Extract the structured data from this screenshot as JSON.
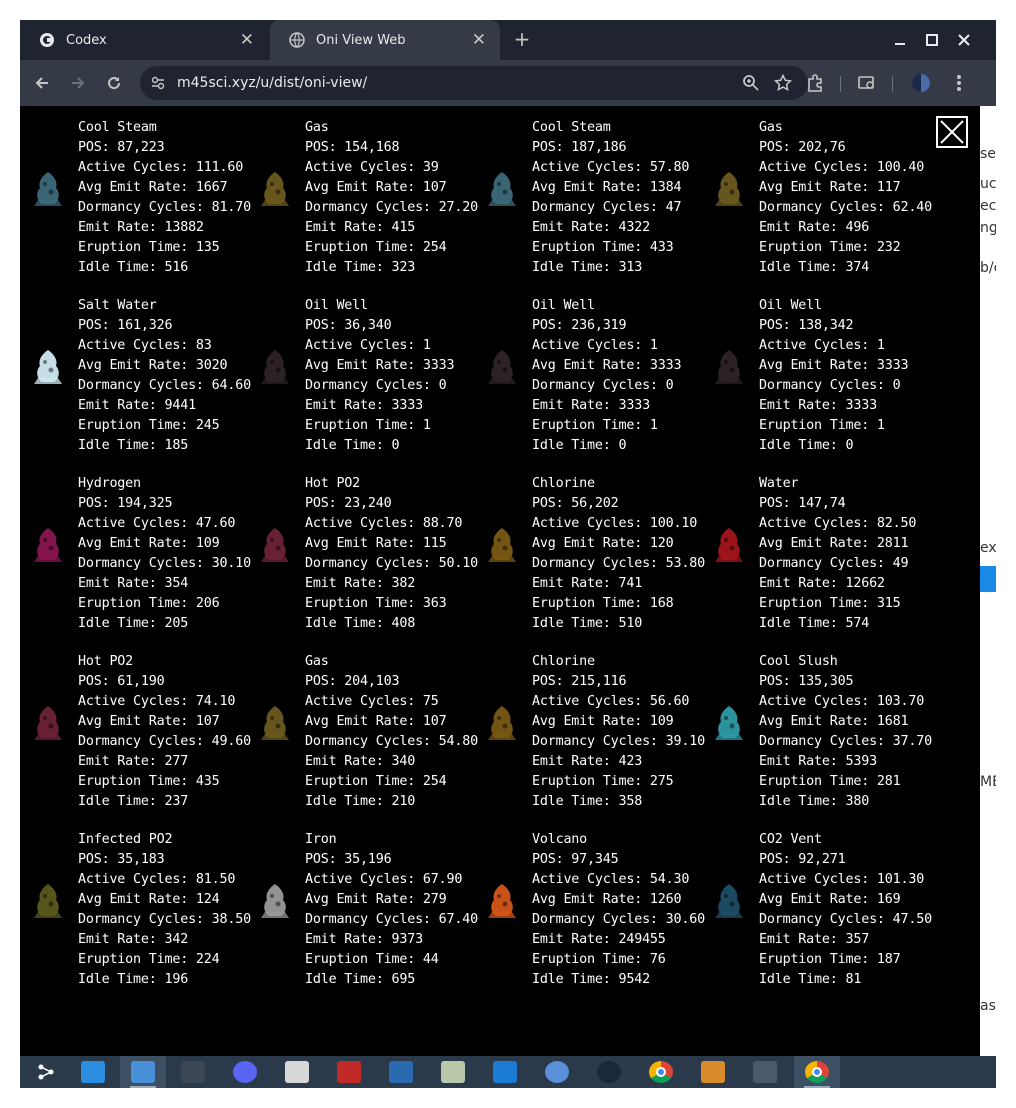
{
  "browser": {
    "tabs": [
      {
        "title": "Codex",
        "active": false
      },
      {
        "title": "Oni View Web",
        "active": true
      }
    ],
    "address": "m45sci.xyz/u/dist/oni-view/"
  },
  "geysers": [
    {
      "name": "Cool Steam",
      "pos": "POS: 87,223",
      "active": "Active Cycles: 111.60",
      "avg": "Avg Emit Rate: 1667",
      "dormancy": "Dormancy Cycles: 81.70",
      "emit": "Emit Rate: 13882",
      "eruption": "Eruption Time: 135",
      "idle": "Idle Time: 516",
      "icon": "cool-steam-vent-icon",
      "color": "#3c6a7a"
    },
    {
      "name": "Gas",
      "pos": "POS: 154,168",
      "active": "Active Cycles: 39",
      "avg": "Avg Emit Rate: 107",
      "dormancy": "Dormancy Cycles: 27.20",
      "emit": "Emit Rate: 415",
      "eruption": "Eruption Time: 254",
      "idle": "Idle Time: 323",
      "icon": "gas-vent-icon",
      "color": "#6b5a1e"
    },
    {
      "name": "Cool Steam",
      "pos": "POS: 187,186",
      "active": "Active Cycles: 57.80",
      "avg": "Avg Emit Rate: 1384",
      "dormancy": "Dormancy Cycles: 47",
      "emit": "Emit Rate: 4322",
      "eruption": "Eruption Time: 433",
      "idle": "Idle Time: 313",
      "icon": "cool-steam-vent-icon",
      "color": "#3c6a7a"
    },
    {
      "name": "Gas",
      "pos": "POS: 202,76",
      "active": "Active Cycles: 100.40",
      "avg": "Avg Emit Rate: 117",
      "dormancy": "Dormancy Cycles: 62.40",
      "emit": "Emit Rate: 496",
      "eruption": "Eruption Time: 232",
      "idle": "Idle Time: 374",
      "icon": "gas-vent-icon",
      "color": "#6b5a1e"
    },
    {
      "name": "Salt Water",
      "pos": "POS: 161,326",
      "active": "Active Cycles: 83",
      "avg": "Avg Emit Rate: 3020",
      "dormancy": "Dormancy Cycles: 64.60",
      "emit": "Emit Rate: 9441",
      "eruption": "Eruption Time: 245",
      "idle": "Idle Time: 185",
      "icon": "salt-water-geyser-icon",
      "color": "#cfe9f2"
    },
    {
      "name": "Oil Well",
      "pos": "POS: 36,340",
      "active": "Active Cycles: 1",
      "avg": "Avg Emit Rate: 3333",
      "dormancy": "Dormancy Cycles: 0",
      "emit": "Emit Rate: 3333",
      "eruption": "Eruption Time: 1",
      "idle": "Idle Time: 0",
      "icon": "oil-well-icon",
      "color": "#2e2428"
    },
    {
      "name": "Oil Well",
      "pos": "POS: 236,319",
      "active": "Active Cycles: 1",
      "avg": "Avg Emit Rate: 3333",
      "dormancy": "Dormancy Cycles: 0",
      "emit": "Emit Rate: 3333",
      "eruption": "Eruption Time: 1",
      "idle": "Idle Time: 0",
      "icon": "oil-well-icon",
      "color": "#2e2428"
    },
    {
      "name": "Oil Well",
      "pos": "POS: 138,342",
      "active": "Active Cycles: 1",
      "avg": "Avg Emit Rate: 3333",
      "dormancy": "Dormancy Cycles: 0",
      "emit": "Emit Rate: 3333",
      "eruption": "Eruption Time: 1",
      "idle": "Idle Time: 0",
      "icon": "oil-well-icon",
      "color": "#2e2428"
    },
    {
      "name": "Hydrogen",
      "pos": "POS: 194,325",
      "active": "Active Cycles: 47.60",
      "avg": "Avg Emit Rate: 109",
      "dormancy": "Dormancy Cycles: 30.10",
      "emit": "Emit Rate: 354",
      "eruption": "Eruption Time: 206",
      "idle": "Idle Time: 205",
      "icon": "hydrogen-vent-icon",
      "color": "#8a1650"
    },
    {
      "name": "Hot PO2",
      "pos": "POS: 23,240",
      "active": "Active Cycles: 88.70",
      "avg": "Avg Emit Rate: 115",
      "dormancy": "Dormancy Cycles: 50.10",
      "emit": "Emit Rate: 382",
      "eruption": "Eruption Time: 363",
      "idle": "Idle Time: 408",
      "icon": "hot-polluted-oxygen-vent-icon",
      "color": "#6e2238"
    },
    {
      "name": "Chlorine",
      "pos": "POS: 56,202",
      "active": "Active Cycles: 100.10",
      "avg": "Avg Emit Rate: 120",
      "dormancy": "Dormancy Cycles: 53.80",
      "emit": "Emit Rate: 741",
      "eruption": "Eruption Time: 168",
      "idle": "Idle Time: 510",
      "icon": "chlorine-vent-icon",
      "color": "#7a5814"
    },
    {
      "name": "Water",
      "pos": "POS: 147,74",
      "active": "Active Cycles: 82.50",
      "avg": "Avg Emit Rate: 2811",
      "dormancy": "Dormancy Cycles: 49",
      "emit": "Emit Rate: 12662",
      "eruption": "Eruption Time: 315",
      "idle": "Idle Time: 574",
      "icon": "water-geyser-icon",
      "color": "#a3151a"
    },
    {
      "name": "Hot PO2",
      "pos": "POS: 61,190",
      "active": "Active Cycles: 74.10",
      "avg": "Avg Emit Rate: 107",
      "dormancy": "Dormancy Cycles: 49.60",
      "emit": "Emit Rate: 277",
      "eruption": "Eruption Time: 435",
      "idle": "Idle Time: 237",
      "icon": "hot-polluted-oxygen-vent-icon",
      "color": "#6e2238"
    },
    {
      "name": "Gas",
      "pos": "POS: 204,103",
      "active": "Active Cycles: 75",
      "avg": "Avg Emit Rate: 107",
      "dormancy": "Dormancy Cycles: 54.80",
      "emit": "Emit Rate: 340",
      "eruption": "Eruption Time: 254",
      "idle": "Idle Time: 210",
      "icon": "gas-vent-icon",
      "color": "#6b5a1e"
    },
    {
      "name": "Chlorine",
      "pos": "POS: 215,116",
      "active": "Active Cycles: 56.60",
      "avg": "Avg Emit Rate: 109",
      "dormancy": "Dormancy Cycles: 39.10",
      "emit": "Emit Rate: 423",
      "eruption": "Eruption Time: 275",
      "idle": "Idle Time: 358",
      "icon": "chlorine-vent-icon",
      "color": "#7a5814"
    },
    {
      "name": "Cool Slush",
      "pos": "POS: 135,305",
      "active": "Active Cycles: 103.70",
      "avg": "Avg Emit Rate: 1681",
      "dormancy": "Dormancy Cycles: 37.70",
      "emit": "Emit Rate: 5393",
      "eruption": "Eruption Time: 281",
      "idle": "Idle Time: 380",
      "icon": "cool-slush-geyser-icon",
      "color": "#2e9aa6"
    },
    {
      "name": "Infected PO2",
      "pos": "POS: 35,183",
      "active": "Active Cycles: 81.50",
      "avg": "Avg Emit Rate: 124",
      "dormancy": "Dormancy Cycles: 38.50",
      "emit": "Emit Rate: 342",
      "eruption": "Eruption Time: 224",
      "idle": "Idle Time: 196",
      "icon": "infected-polluted-oxygen-vent-icon",
      "color": "#5a5a1e"
    },
    {
      "name": "Iron",
      "pos": "POS: 35,196",
      "active": "Active Cycles: 67.90",
      "avg": "Avg Emit Rate: 279",
      "dormancy": "Dormancy Cycles: 67.40",
      "emit": "Emit Rate: 9373",
      "eruption": "Eruption Time: 44",
      "idle": "Idle Time: 695",
      "icon": "iron-volcano-icon",
      "color": "#9a9a9a"
    },
    {
      "name": "Volcano",
      "pos": "POS: 97,345",
      "active": "Active Cycles: 54.30",
      "avg": "Avg Emit Rate: 1260",
      "dormancy": "Dormancy Cycles: 30.60",
      "emit": "Emit Rate: 249455",
      "eruption": "Eruption Time: 76",
      "idle": "Idle Time: 9542",
      "icon": "volcano-icon",
      "color": "#d4561a"
    },
    {
      "name": "CO2 Vent",
      "pos": "POS: 92,271",
      "active": "Active Cycles: 101.30",
      "avg": "Avg Emit Rate: 169",
      "dormancy": "Dormancy Cycles: 47.50",
      "emit": "Emit Rate: 357",
      "eruption": "Eruption Time: 187",
      "idle": "Idle Time: 81",
      "icon": "co2-vent-icon",
      "color": "#1e4e66"
    }
  ],
  "side_strip": [
    "se",
    "uc",
    "ec",
    "ng",
    "b/c",
    "exe",
    "ME",
    "ast"
  ],
  "taskbar": {
    "items": [
      "app-menu-icon",
      "store-icon",
      "files-icon",
      "terminal-icon",
      "discord-icon",
      "calculator-icon",
      "filezilla-icon",
      "writer-icon",
      "network-icon",
      "flight-icon",
      "docker-icon",
      "steam-icon",
      "chrome-icon",
      "mixer-icon",
      "settings-icon",
      "chrome-icon"
    ],
    "colors": [
      "#ffffff",
      "#2a8de0",
      "#4a90d9",
      "#3a4654",
      "#5865f2",
      "#d7d7d7",
      "#bf2a26",
      "#2a6ab0",
      "#b8c8a8",
      "#1a7ad4",
      "#5b8fd9",
      "#1b2838",
      "#db4437",
      "#d98a2a",
      "#4a5a6a",
      "#db4437"
    ]
  }
}
